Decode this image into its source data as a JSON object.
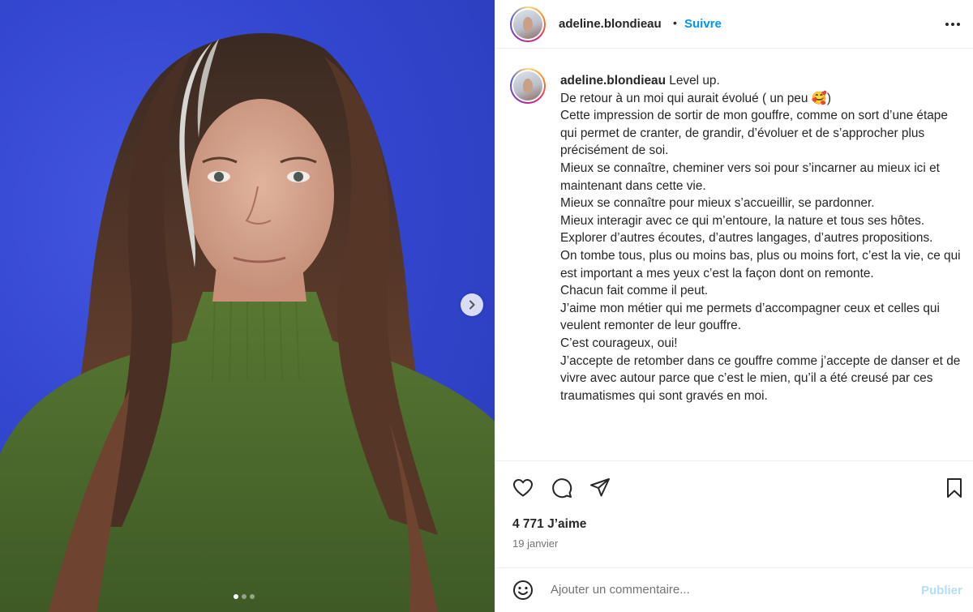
{
  "post": {
    "username": "adeline.blondieau",
    "separator": "•",
    "follow_label": "Suivre",
    "caption_username": "adeline.blondieau",
    "caption_text": " Level up.\nDe retour à un moi qui aurait évolué ( un peu 🥰)\nCette impression de sortir de mon gouffre, comme on sort d’une étape qui permet de cranter, de grandir, d’évoluer et de s’approcher plus précisément de soi.\nMieux se connaître, cheminer vers soi pour s’incarner au mieux ici et maintenant dans cette vie.\nMieux se connaître pour mieux s’accueillir, se pardonner.\nMieux interagir avec ce qui m’entoure, la nature et tous ses hôtes.\nExplorer d’autres écoutes, d’autres langages, d’autres propositions.\nOn tombe tous, plus ou moins bas, plus ou moins fort, c’est la vie, ce qui est important a mes yeux c’est la façon dont on remonte.\nChacun fait comme il peut.\nJ’aime mon métier qui me permets d’accompagner ceux et celles qui veulent remonter de leur gouffre.\nC’est courageux, oui!\nJ’accepte de retomber dans ce gouffre comme j’accepte de danser et de vivre avec autour parce que c’est le mien, qu’il a été creusé par ces traumatismes qui sont gravés en moi.",
    "likes_label": "4 771 J’aime",
    "date_label": "19 janvier",
    "comment_placeholder": "Ajouter un commentaire...",
    "publish_label": "Publier"
  },
  "carousel": {
    "slide_count": 3,
    "active_slide": 1
  },
  "icons": {
    "more": "more-options-icon",
    "next": "chevron-right-icon",
    "like": "heart-icon",
    "comment": "comment-icon",
    "share": "paper-plane-icon",
    "save": "bookmark-icon",
    "emoji": "emoji-icon"
  },
  "colors": {
    "link_blue": "#0095f6",
    "publish_disabled": "#b2dffc",
    "backdrop_blue": "#3346cf",
    "sweater_green": "#4e6b2e"
  }
}
